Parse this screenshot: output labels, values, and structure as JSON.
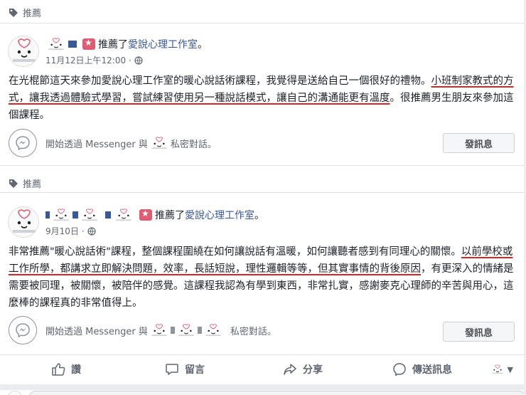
{
  "section_label": "推薦",
  "posts": [
    {
      "recommends_verb": "推薦了",
      "page_name": "愛說心理工作室",
      "period": "。",
      "timestamp": "11月12日上午12:00",
      "meta_sep": "·",
      "body_plain_1": "在光棍節這天來參加愛說心理工作室的暖心說話術課程，我覺得是送給自己一個很好的禮物。",
      "body_u_1": "小班制家教式的方式，讓我透過體驗式學習，嘗試練習使用另一種說話模式，讓自己的溝通能更有溫度",
      "body_plain_2": "。很推薦男生朋友來參加這個課程。",
      "messenger_prefix": "開始透過 Messenger 與",
      "messenger_suffix": "私密對話。",
      "message_button": "發訊息"
    },
    {
      "recommends_verb": "推薦了",
      "page_name": "愛說心理工作室",
      "period": "。",
      "timestamp": "9月10日",
      "meta_sep": "·",
      "body_plain_1": "非常推薦\"暖心說話術\"課程，整個課程圍繞在如何讓說話有溫暖，如何讓聽者感到有同理心的關懷。",
      "body_u_1": "以前學校或工作所學，都講求立即解決問題，效率，長話短說，理性邏輯等等，但其實事情的背後原因",
      "body_plain_2": "，有更深入的情緒是需要被同理，被關懷，被陪伴的感覺。這課程我認為有學到東西，非常扎實，感謝麥克心理師的辛苦與用心，這麼棒的課程真的非常值得上。",
      "messenger_prefix": "開始透過 Messenger 與",
      "messenger_suffix": "私密對話。",
      "message_button": "發訊息"
    }
  ],
  "actions": {
    "like": "讚",
    "comment": "留言",
    "share": "分享",
    "send": "傳送訊息"
  },
  "colors": {
    "link": "#385898",
    "underline": "#dd2222",
    "badge": "#e05a72"
  }
}
